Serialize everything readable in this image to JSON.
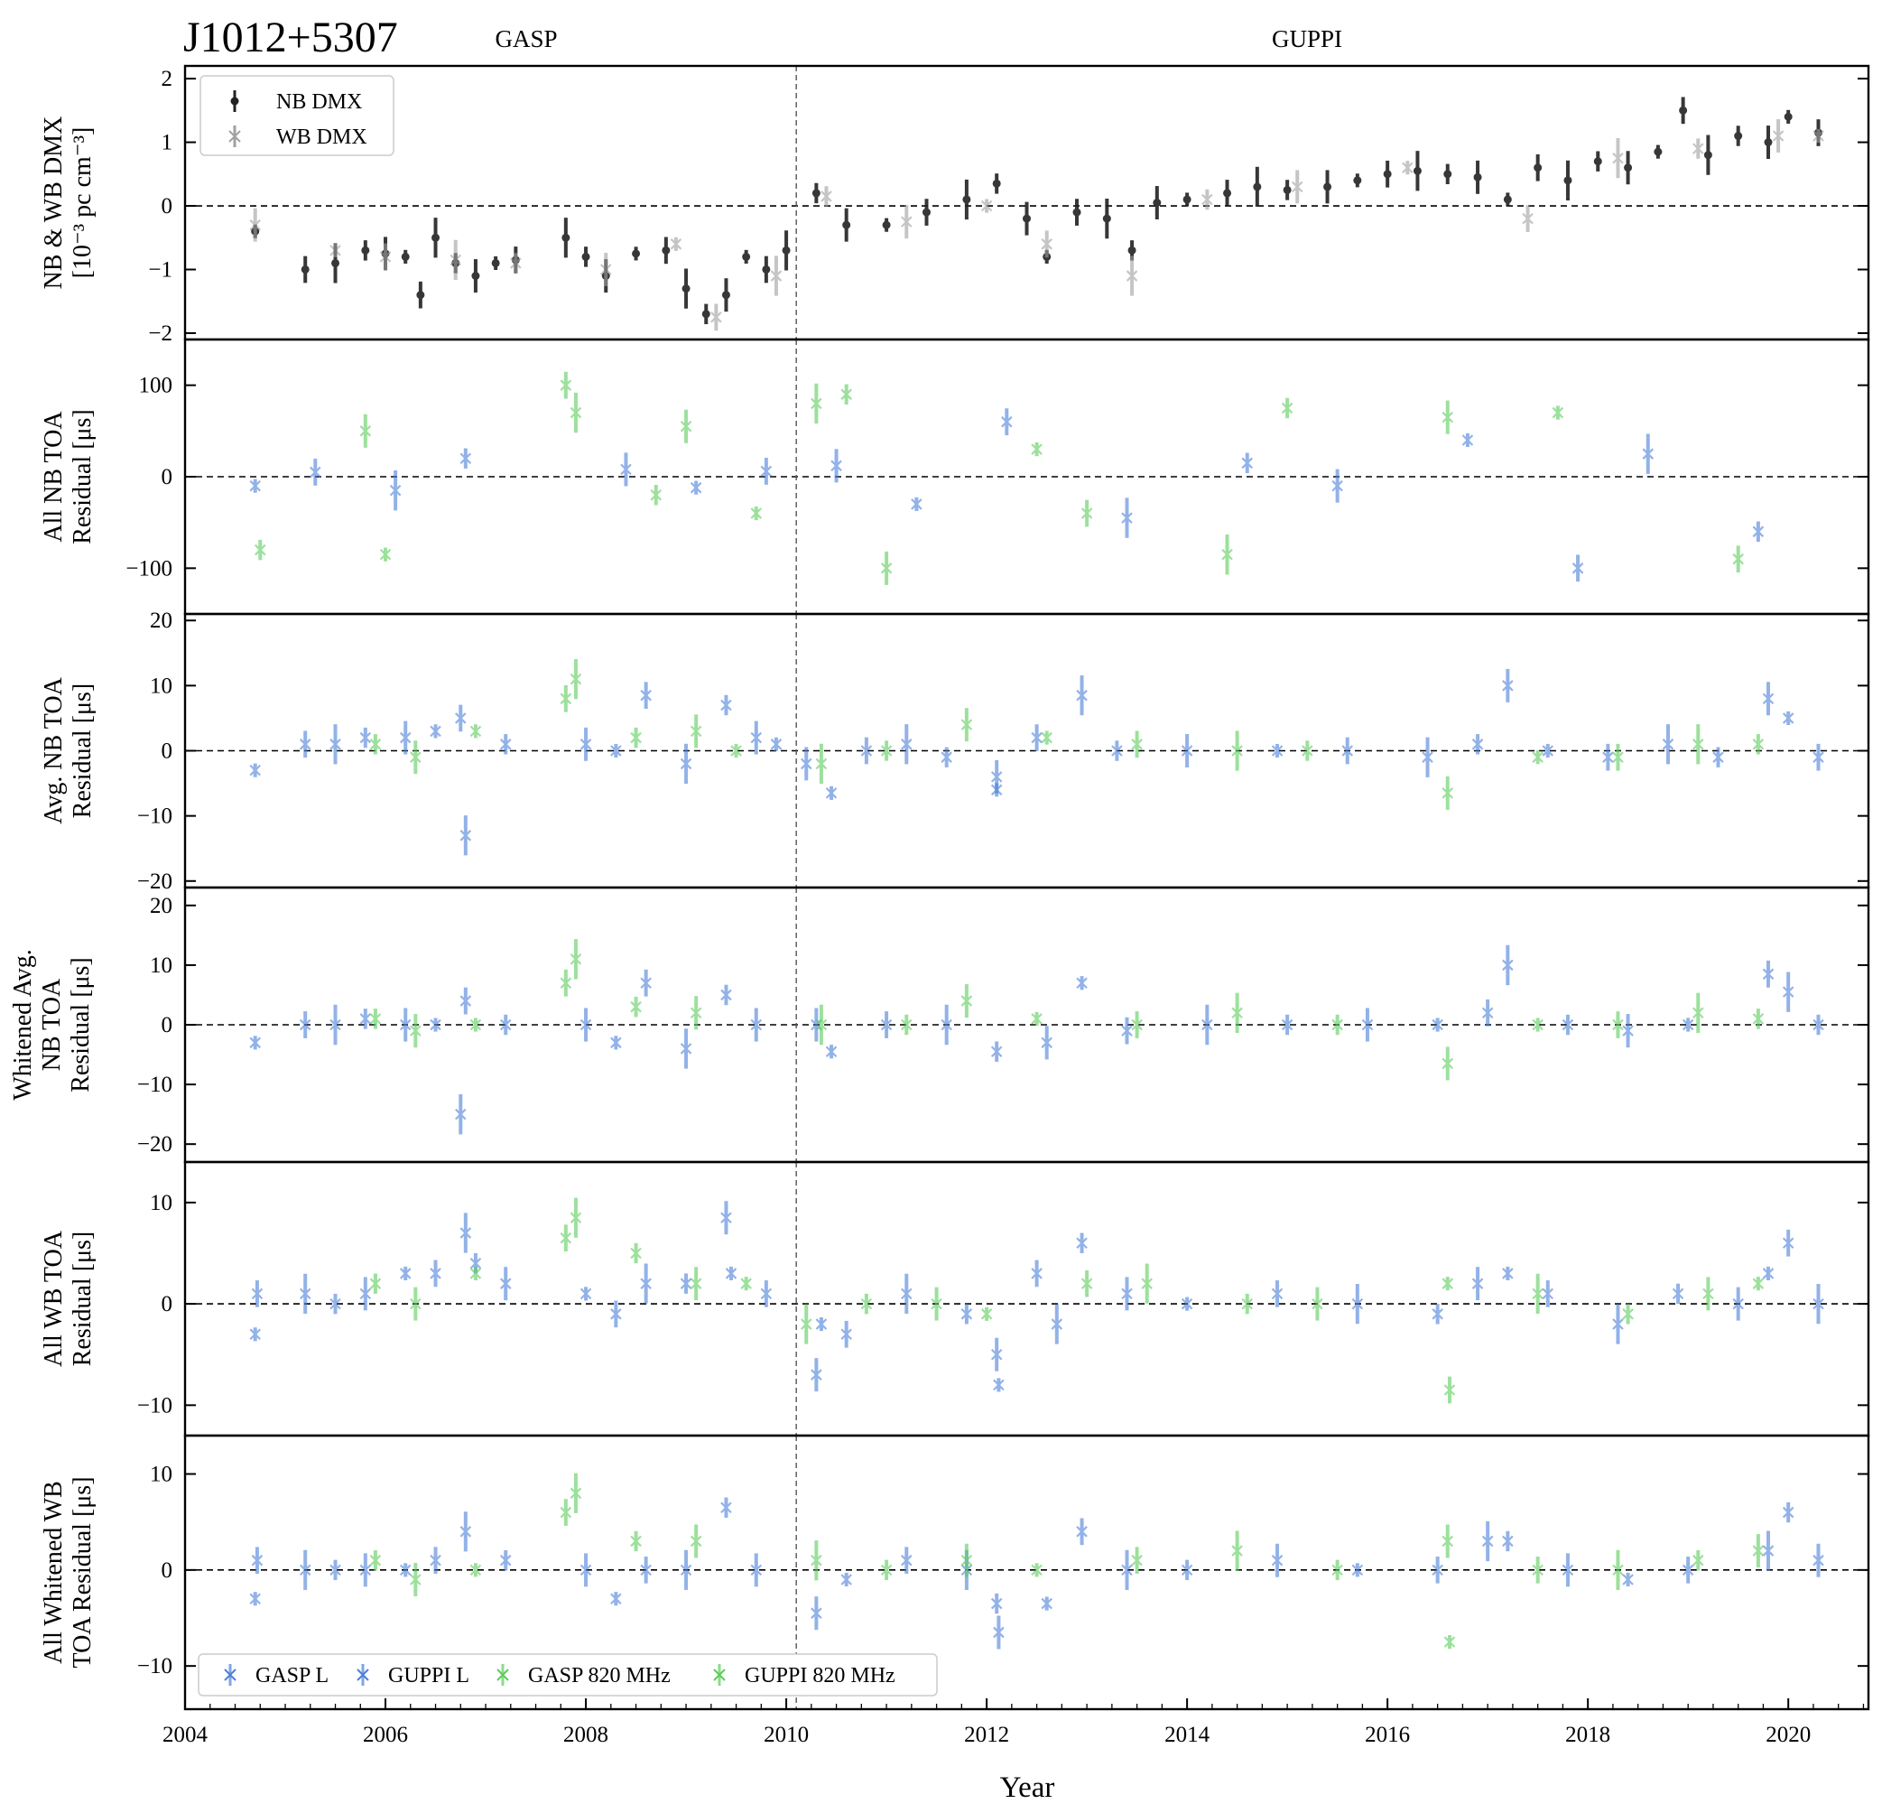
{
  "figure": {
    "pulsar": "J1012+5307",
    "backend_labels": [
      "GASP",
      "GUPPI"
    ],
    "xlabel": "Year",
    "x_ticks": [
      2004,
      2006,
      2008,
      2010,
      2012,
      2014,
      2016,
      2018,
      2020
    ],
    "x_range": [
      2004.0,
      2020.8
    ],
    "backend_switch_year": 2010.1
  },
  "colors": {
    "GASP L": "#4a7fd9",
    "GUPPI L": "#4a7fd9",
    "GASP 820 MHz": "#5ccc5c",
    "GUPPI 820 MHz": "#5ccc5c",
    "NB DMX": "#222222",
    "WB DMX": "#a0a0a0"
  },
  "chart_data": [
    {
      "type": "scatter",
      "panel": "dmx",
      "ylabel_lines": [
        "NB & WB DMX",
        "[10⁻³ pc cm⁻³]"
      ],
      "ylim": [
        -2.1,
        2.2
      ],
      "y_ticks": [
        -2,
        -1,
        0,
        1,
        2
      ],
      "y_tick_labels": [
        "−2",
        "−1",
        "0",
        "1",
        "2"
      ],
      "legend": [
        "NB DMX",
        "WB DMX"
      ],
      "legend_position": "top-left",
      "series": [
        {
          "name": "NB DMX",
          "x": [
            2004.7,
            2005.2,
            2005.5,
            2005.8,
            2006.0,
            2006.2,
            2006.35,
            2006.5,
            2006.7,
            2006.9,
            2007.1,
            2007.3,
            2007.8,
            2008.0,
            2008.2,
            2008.5,
            2008.8,
            2009.0,
            2009.2,
            2009.4,
            2009.6,
            2009.8,
            2010.0,
            2010.3,
            2010.6,
            2011.0,
            2011.4,
            2011.8,
            2012.1,
            2012.4,
            2012.6,
            2012.9,
            2013.2,
            2013.45,
            2013.7,
            2014.0,
            2014.4,
            2014.7,
            2015.0,
            2015.4,
            2015.7,
            2016.0,
            2016.3,
            2016.6,
            2016.9,
            2017.2,
            2017.5,
            2017.8,
            2018.1,
            2018.4,
            2018.7,
            2018.95,
            2019.2,
            2019.5,
            2019.8,
            2020.0,
            2020.3
          ],
          "y": [
            -0.4,
            -1.0,
            -0.9,
            -0.7,
            -0.75,
            -0.8,
            -1.4,
            -0.5,
            -0.9,
            -1.1,
            -0.9,
            -0.85,
            -0.5,
            -0.8,
            -1.1,
            -0.75,
            -0.7,
            -1.3,
            -1.7,
            -1.4,
            -0.8,
            -1.0,
            -0.7,
            0.2,
            -0.3,
            -0.3,
            -0.1,
            0.1,
            0.35,
            -0.2,
            -0.8,
            -0.1,
            -0.2,
            -0.7,
            0.05,
            0.1,
            0.2,
            0.3,
            0.25,
            0.3,
            0.4,
            0.5,
            0.55,
            0.5,
            0.45,
            0.1,
            0.6,
            0.4,
            0.7,
            0.6,
            0.85,
            1.5,
            0.8,
            1.1,
            1.0,
            1.4,
            1.15
          ]
        },
        {
          "name": "WB DMX",
          "x": [
            2004.7,
            2005.5,
            2006.0,
            2006.7,
            2007.3,
            2008.2,
            2008.9,
            2009.3,
            2009.9,
            2010.4,
            2011.2,
            2012.0,
            2012.6,
            2013.45,
            2014.2,
            2015.1,
            2016.2,
            2017.4,
            2018.3,
            2019.1,
            2019.9,
            2020.3
          ],
          "y": [
            -0.3,
            -0.7,
            -0.8,
            -0.85,
            -0.9,
            -1.0,
            -0.6,
            -1.75,
            -1.1,
            0.15,
            -0.25,
            0.0,
            -0.6,
            -1.1,
            0.1,
            0.3,
            0.6,
            -0.2,
            0.75,
            0.9,
            1.1,
            1.1
          ]
        }
      ]
    },
    {
      "type": "scatter",
      "panel": "all-nb-toa",
      "ylabel_lines": [
        "All NB TOA",
        "Residual [μs]"
      ],
      "ylim": [
        -150,
        150
      ],
      "y_ticks": [
        -100,
        0,
        100
      ],
      "y_tick_labels": [
        "−100",
        "0",
        "100"
      ],
      "series": [
        {
          "name": "GASP L",
          "x": [
            2004.7,
            2005.3,
            2006.1,
            2006.8,
            2008.4,
            2009.1,
            2009.8
          ],
          "y": [
            -10,
            5,
            -15,
            20,
            8,
            -12,
            6
          ]
        },
        {
          "name": "GUPPI L",
          "x": [
            2010.5,
            2011.3,
            2012.2,
            2013.4,
            2014.6,
            2015.5,
            2016.8,
            2017.9,
            2018.6,
            2019.7
          ],
          "y": [
            12,
            -30,
            60,
            -45,
            15,
            -10,
            40,
            -100,
            25,
            -60
          ]
        },
        {
          "name": "GASP 820 MHz",
          "x": [
            2004.75,
            2005.8,
            2006.0,
            2007.8,
            2007.9,
            2008.7,
            2009.0,
            2009.7
          ],
          "y": [
            -80,
            50,
            -85,
            100,
            70,
            -20,
            55,
            -40
          ]
        },
        {
          "name": "GUPPI 820 MHz",
          "x": [
            2010.3,
            2010.6,
            2011.0,
            2012.5,
            2013.0,
            2014.4,
            2015.0,
            2016.6,
            2017.7,
            2019.5
          ],
          "y": [
            80,
            90,
            -100,
            30,
            -40,
            -85,
            75,
            65,
            70,
            -90
          ]
        }
      ]
    },
    {
      "type": "scatter",
      "panel": "avg-nb-toa",
      "ylabel_lines": [
        "Avg. NB TOA",
        "Residual [μs]"
      ],
      "ylim": [
        -21,
        21
      ],
      "y_ticks": [
        -20,
        -10,
        0,
        10,
        20
      ],
      "y_tick_labels": [
        "−20",
        "−10",
        "0",
        "10",
        "20"
      ],
      "series": [
        {
          "name": "GASP L",
          "x": [
            2004.7,
            2005.2,
            2005.5,
            2005.8,
            2006.2,
            2006.5,
            2006.75,
            2006.8,
            2007.2,
            2008.0,
            2008.3,
            2008.6,
            2009.0,
            2009.4,
            2009.7,
            2009.9
          ],
          "y": [
            -3,
            1,
            1,
            2,
            2,
            3,
            5,
            -13,
            1,
            1,
            0,
            8.5,
            -2,
            7,
            2,
            1
          ]
        },
        {
          "name": "GUPPI L",
          "x": [
            2010.2,
            2010.45,
            2010.8,
            2011.2,
            2011.6,
            2012.1,
            2012.1,
            2012.5,
            2012.95,
            2013.3,
            2014.0,
            2014.9,
            2015.6,
            2016.4,
            2016.9,
            2017.2,
            2017.6,
            2018.2,
            2018.8,
            2019.3,
            2019.8,
            2020.0,
            2020.3
          ],
          "y": [
            -2,
            -6.5,
            0,
            1,
            -1,
            -4,
            -6,
            2,
            8.5,
            0,
            0,
            0,
            0,
            -1,
            1,
            10,
            0,
            -1,
            1,
            -1,
            8,
            5,
            -1
          ]
        },
        {
          "name": "GASP 820 MHz",
          "x": [
            2005.9,
            2006.3,
            2006.9,
            2007.8,
            2007.9,
            2008.5,
            2009.1,
            2009.5
          ],
          "y": [
            1,
            -1,
            3,
            8,
            11,
            2,
            3,
            0
          ]
        },
        {
          "name": "GUPPI 820 MHz",
          "x": [
            2010.35,
            2011.0,
            2011.8,
            2012.6,
            2013.5,
            2014.5,
            2015.2,
            2016.6,
            2017.5,
            2018.3,
            2019.1,
            2019.7
          ],
          "y": [
            -2,
            0,
            4,
            2,
            1,
            0,
            0,
            -6.5,
            -1,
            -1,
            1,
            1
          ]
        }
      ]
    },
    {
      "type": "scatter",
      "panel": "whitened-avg-nb-toa",
      "ylabel_lines": [
        "Whitened Avg.",
        "NB TOA",
        "Residual [μs]"
      ],
      "ylim": [
        -23,
        23
      ],
      "y_ticks": [
        -20,
        -10,
        0,
        10,
        20
      ],
      "y_tick_labels": [
        "−20",
        "−10",
        "0",
        "10",
        "20"
      ],
      "series": [
        {
          "name": "GASP L",
          "x": [
            2004.7,
            2005.2,
            2005.5,
            2005.8,
            2006.2,
            2006.5,
            2006.8,
            2006.75,
            2007.2,
            2008.0,
            2008.3,
            2008.6,
            2009.0,
            2009.4,
            2009.7
          ],
          "y": [
            -3,
            0,
            0,
            1,
            0,
            0,
            4,
            -15,
            0,
            0,
            -3,
            7,
            -4,
            5,
            0
          ]
        },
        {
          "name": "GUPPI L",
          "x": [
            2010.3,
            2010.45,
            2011.0,
            2011.6,
            2012.1,
            2012.6,
            2012.95,
            2013.4,
            2014.2,
            2015.0,
            2015.8,
            2016.5,
            2017.0,
            2017.2,
            2017.8,
            2018.4,
            2019.0,
            2019.8,
            2020.0,
            2020.3
          ],
          "y": [
            0,
            -4.5,
            0,
            0,
            -4.5,
            -3,
            7,
            -1,
            0,
            0,
            0,
            0,
            2,
            10,
            0,
            -1,
            0,
            8.5,
            5.5,
            0
          ]
        },
        {
          "name": "GASP 820 MHz",
          "x": [
            2005.9,
            2006.3,
            2006.9,
            2007.8,
            2007.9,
            2008.5,
            2009.1
          ],
          "y": [
            1,
            -1,
            0,
            7,
            11,
            3,
            2
          ]
        },
        {
          "name": "GUPPI 820 MHz",
          "x": [
            2010.35,
            2011.2,
            2011.8,
            2012.5,
            2013.5,
            2014.5,
            2015.5,
            2016.6,
            2017.5,
            2018.3,
            2019.1,
            2019.7
          ],
          "y": [
            0,
            0,
            4,
            1,
            0,
            2,
            0,
            -6.5,
            0,
            0,
            2,
            1
          ]
        }
      ]
    },
    {
      "type": "scatter",
      "panel": "all-wb-toa",
      "ylabel_lines": [
        "All WB TOA",
        "Residual [μs]"
      ],
      "ylim": [
        -13,
        14
      ],
      "y_ticks": [
        -10,
        0,
        10
      ],
      "y_tick_labels": [
        "−10",
        "0",
        "10"
      ],
      "series": [
        {
          "name": "GASP L",
          "x": [
            2004.7,
            2004.72,
            2005.2,
            2005.5,
            2005.8,
            2006.2,
            2006.5,
            2006.8,
            2006.9,
            2007.2,
            2008.0,
            2008.3,
            2008.6,
            2009.0,
            2009.4,
            2009.45,
            2009.8
          ],
          "y": [
            -3,
            1,
            1,
            0,
            1,
            3,
            3,
            7,
            4,
            2,
            1,
            -1,
            2,
            2,
            8.5,
            3,
            1
          ]
        },
        {
          "name": "GUPPI L",
          "x": [
            2010.3,
            2010.35,
            2010.6,
            2011.2,
            2011.8,
            2012.1,
            2012.12,
            2012.5,
            2012.7,
            2012.95,
            2013.4,
            2014.0,
            2014.9,
            2015.7,
            2016.5,
            2016.9,
            2017.2,
            2017.6,
            2018.3,
            2018.9,
            2019.5,
            2019.8,
            2020.0,
            2020.3
          ],
          "y": [
            -7,
            -2,
            -3,
            1,
            -1,
            -5,
            -8,
            3,
            -2,
            6,
            1,
            0,
            1,
            0,
            -1,
            2,
            3,
            1,
            -2,
            1,
            0,
            3,
            6,
            0
          ]
        },
        {
          "name": "GASP 820 MHz",
          "x": [
            2005.9,
            2006.3,
            2006.9,
            2007.8,
            2007.9,
            2008.5,
            2009.1,
            2009.6
          ],
          "y": [
            2,
            0,
            3,
            6.5,
            8.5,
            5,
            2,
            2
          ]
        },
        {
          "name": "GUPPI 820 MHz",
          "x": [
            2010.2,
            2010.8,
            2011.5,
            2012.0,
            2013.0,
            2013.6,
            2014.6,
            2015.3,
            2016.6,
            2016.62,
            2017.5,
            2018.4,
            2019.2,
            2019.7
          ],
          "y": [
            -2,
            0,
            0,
            -1,
            2,
            2,
            0,
            0,
            2,
            -8.5,
            1,
            -1,
            1,
            2
          ]
        }
      ]
    },
    {
      "type": "scatter",
      "panel": "all-whitened-wb-toa",
      "ylabel_lines": [
        "All Whitened WB",
        "TOA Residual [μs]"
      ],
      "ylim": [
        -14.5,
        14
      ],
      "y_ticks": [
        -10,
        0,
        10
      ],
      "y_tick_labels": [
        "−10",
        "0",
        "10"
      ],
      "legend": [
        "GASP L",
        "GUPPI L",
        "GASP 820 MHz",
        "GUPPI 820 MHz"
      ],
      "legend_position": "bottom-left",
      "series": [
        {
          "name": "GASP L",
          "x": [
            2004.7,
            2004.72,
            2005.2,
            2005.5,
            2005.8,
            2006.2,
            2006.5,
            2006.8,
            2007.2,
            2008.0,
            2008.3,
            2008.6,
            2009.0,
            2009.4,
            2009.7
          ],
          "y": [
            -3,
            1,
            0,
            0,
            0,
            0,
            1,
            4,
            1,
            0,
            -3,
            0,
            0,
            6.5,
            0
          ]
        },
        {
          "name": "GUPPI L",
          "x": [
            2010.3,
            2010.6,
            2011.2,
            2011.8,
            2012.1,
            2012.12,
            2012.6,
            2012.95,
            2013.4,
            2014.0,
            2014.9,
            2015.7,
            2016.5,
            2017.0,
            2017.2,
            2017.8,
            2018.4,
            2019.0,
            2019.8,
            2020.0,
            2020.3
          ],
          "y": [
            -4.5,
            -1,
            1,
            0,
            -3.5,
            -6.5,
            -3.5,
            4,
            0,
            0,
            1,
            0,
            0,
            3,
            3,
            0,
            -1,
            0,
            2,
            6,
            1
          ]
        },
        {
          "name": "GASP 820 MHz",
          "x": [
            2005.9,
            2006.3,
            2006.9,
            2007.8,
            2007.9,
            2008.5,
            2009.1
          ],
          "y": [
            1,
            -1,
            0,
            6,
            8,
            3,
            3
          ]
        },
        {
          "name": "GUPPI 820 MHz",
          "x": [
            2010.3,
            2011.0,
            2011.8,
            2012.5,
            2013.5,
            2014.5,
            2015.5,
            2016.6,
            2016.62,
            2017.5,
            2018.3,
            2019.1,
            2019.7
          ],
          "y": [
            1,
            0,
            1,
            0,
            1,
            2,
            0,
            3,
            -7.5,
            0,
            0,
            1,
            2
          ]
        }
      ]
    }
  ]
}
